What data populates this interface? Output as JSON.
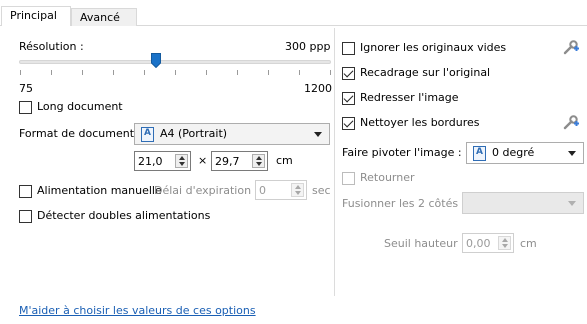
{
  "tabs": [
    {
      "label": "Principal",
      "active": true
    },
    {
      "label": "Avancé",
      "active": false
    }
  ],
  "resolution": {
    "label": "Résolution :",
    "value": "300 ppp",
    "min_label": "75",
    "max_label": "1200",
    "level": 0.31
  },
  "left": {
    "long_document": {
      "label": "Long document",
      "checked": false
    },
    "format": {
      "label": "Format de document :",
      "value": "A4 (Portrait)",
      "width": "21,0",
      "height": "29,7",
      "times": "×",
      "unit": "cm"
    },
    "manual_feed": {
      "label": "Alimentation manuelle",
      "checked": false,
      "timeout_label": "Délai d'expiration :",
      "timeout_value": "0",
      "timeout_unit": "sec"
    },
    "double_feed": {
      "label": "Détecter doubles alimentations",
      "checked": false
    }
  },
  "right": {
    "ignore_blank": {
      "label": "Ignorer les originaux vides",
      "checked": false
    },
    "crop": {
      "label": "Recadrage sur l'original",
      "checked": true
    },
    "deskew": {
      "label": "Redresser l'image",
      "checked": true
    },
    "clean_borders": {
      "label": "Nettoyer les bordures",
      "checked": true
    },
    "rotate": {
      "label": "Faire pivoter l'image :",
      "value": "0 degré"
    },
    "flip": {
      "label": "Retourner",
      "checked": false
    },
    "merge": {
      "label": "Fusionner les 2 côtés :",
      "value": ""
    },
    "height_threshold": {
      "label": "Seuil hauteur :",
      "value": "0,00",
      "unit": "cm"
    }
  },
  "help_link": "M'aider à choisir les valeurs de ces options",
  "colors": {
    "accent": "#1a72c8",
    "link": "#1a5fb4",
    "wrench_gray": "#8c8c8c",
    "plus_blue": "#3b7dd8"
  }
}
